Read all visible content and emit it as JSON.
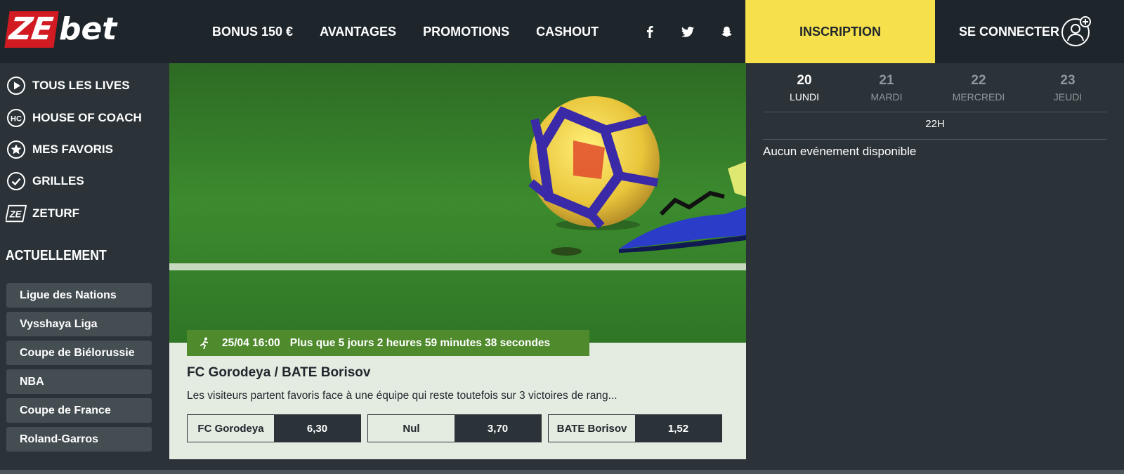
{
  "header": {
    "logo_ze": "ZE",
    "logo_bet": "bet",
    "nav": [
      "BONUS 150 €",
      "AVANTAGES",
      "PROMOTIONS",
      "CASHOUT"
    ],
    "social_icons": [
      "facebook-icon",
      "twitter-icon",
      "snapchat-icon"
    ],
    "inscription_label": "INSCRIPTION",
    "connect_label": "SE CONNECTER"
  },
  "sidebar": {
    "items": [
      {
        "label": "TOUS LES LIVES",
        "icon": "play-icon"
      },
      {
        "label": "HOUSE OF COACH",
        "icon": "house-of-coach-icon"
      },
      {
        "label": "MES FAVORIS",
        "icon": "star-icon"
      },
      {
        "label": "GRILLES",
        "icon": "check-icon"
      },
      {
        "label": "ZETURF",
        "icon": "zeturf-icon"
      }
    ],
    "section_title": "ACTUELLEMENT",
    "leagues": [
      "Ligue des Nations",
      "Vysshaya Liga",
      "Coupe de Biélorussie",
      "NBA",
      "Coupe de France",
      "Roland-Garros"
    ]
  },
  "match": {
    "date": "25/04 16:00",
    "countdown": "Plus que 5 jours 2 heures 59 minutes 38 secondes",
    "title": "FC Gorodeya / BATE Borisov",
    "description": "Les visiteurs partent favoris face à une équipe qui reste toutefois sur 3 victoires de rang...",
    "odds": [
      {
        "label": "FC Gorodeya",
        "value": "6,30"
      },
      {
        "label": "Nul",
        "value": "3,70"
      },
      {
        "label": "BATE Borisov",
        "value": "1,52"
      }
    ]
  },
  "schedule": {
    "days": [
      {
        "num": "20",
        "name": "LUNDI",
        "active": true
      },
      {
        "num": "21",
        "name": "MARDI",
        "active": false
      },
      {
        "num": "22",
        "name": "MERCREDI",
        "active": false
      },
      {
        "num": "23",
        "name": "JEUDI",
        "active": false
      }
    ],
    "hour": "22H",
    "empty_message": "Aucun evénement disponible"
  },
  "colors": {
    "header_bg": "#1e262c",
    "panel_bg": "#2b3338",
    "accent_yellow": "#f6e04c",
    "brand_red": "#d21a22",
    "badge_green": "#4f8a2c"
  }
}
